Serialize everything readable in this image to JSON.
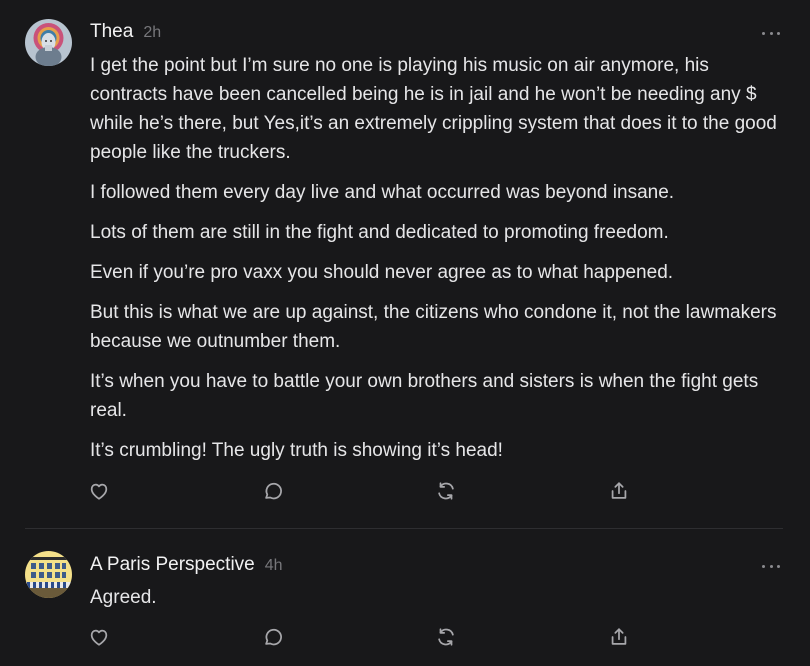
{
  "comments": [
    {
      "author": "Thea",
      "time": "2h",
      "paragraphs": [
        "I get the point but I’m sure no one is playing his music on air anymore, his contracts have been cancelled being he is in jail and he won’t be needing any $ while he’s there, but Yes,it’s an extremely crippling system that does it to the good people like the truckers.",
        "I followed them every day live and what occurred was beyond insane.",
        "Lots of them are still in the fight and dedicated to promoting freedom.",
        "Even if you’re pro vaxx you should never agree as to what happened.",
        "But this is what we are up against, the citizens who condone it, not the lawmakers because we outnumber them.",
        "It’s when you have to battle your own brothers and sisters is when the fight gets real.",
        "It’s crumbling! The ugly truth is showing it’s head!"
      ],
      "actions": [
        "heart-icon",
        "comment-icon",
        "restack-icon",
        "share-icon"
      ]
    },
    {
      "author": "A Paris Perspective",
      "time": "4h",
      "paragraphs": [
        "Agreed."
      ],
      "actions": [
        "heart-icon",
        "comment-icon",
        "restack-icon",
        "share-icon"
      ]
    }
  ],
  "colors": {
    "background": "#18181a",
    "text": "#e6e6e8",
    "muted": "#77777b",
    "icon": "#a7a7ab"
  }
}
